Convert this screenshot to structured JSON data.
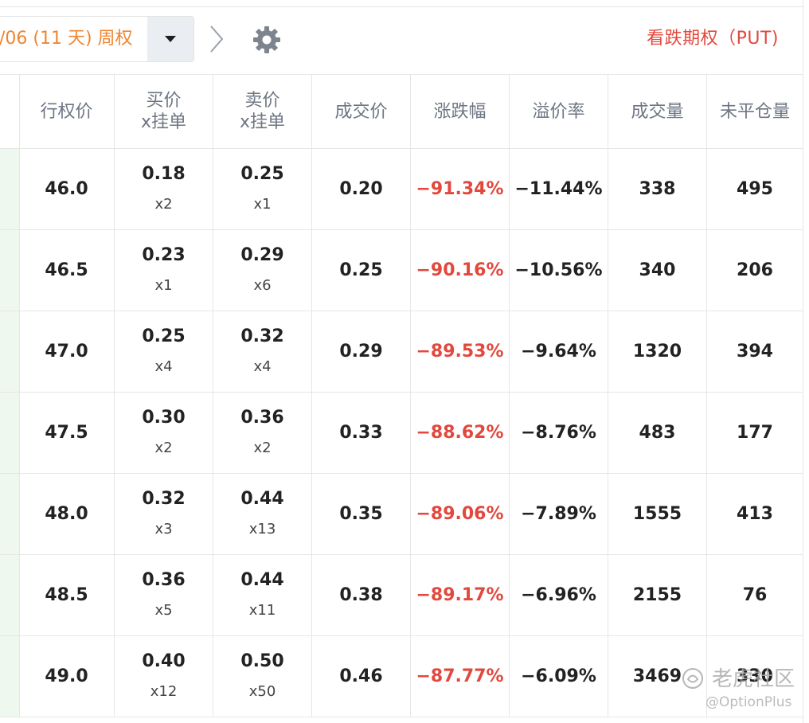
{
  "toolbar": {
    "expiry_label": "/06 (11 天) 周权",
    "put_label": "看跌期权（PUT)",
    "icons": {
      "caret": "caret-down-icon",
      "next": "chevron-right-icon",
      "settings": "gear-icon"
    }
  },
  "table": {
    "headers": {
      "strike": "行权价",
      "bid_line1": "买价",
      "bid_line2": "x挂单",
      "ask_line1": "卖价",
      "ask_line2": "x挂单",
      "last": "成交价",
      "change": "涨跌幅",
      "premium": "溢价率",
      "volume": "成交量",
      "open_interest": "未平仓量"
    },
    "rows": [
      {
        "strike": "46.0",
        "bid": "0.18",
        "bid_size": "x2",
        "ask": "0.25",
        "ask_size": "x1",
        "last": "0.20",
        "change": "−91.34%",
        "premium": "−11.44%",
        "volume": "338",
        "oi": "495"
      },
      {
        "strike": "46.5",
        "bid": "0.23",
        "bid_size": "x1",
        "ask": "0.29",
        "ask_size": "x6",
        "last": "0.25",
        "change": "−90.16%",
        "premium": "−10.56%",
        "volume": "340",
        "oi": "206"
      },
      {
        "strike": "47.0",
        "bid": "0.25",
        "bid_size": "x4",
        "ask": "0.32",
        "ask_size": "x4",
        "last": "0.29",
        "change": "−89.53%",
        "premium": "−9.64%",
        "volume": "1320",
        "oi": "394"
      },
      {
        "strike": "47.5",
        "bid": "0.30",
        "bid_size": "x2",
        "ask": "0.36",
        "ask_size": "x2",
        "last": "0.33",
        "change": "−88.62%",
        "premium": "−8.76%",
        "volume": "483",
        "oi": "177"
      },
      {
        "strike": "48.0",
        "bid": "0.32",
        "bid_size": "x3",
        "ask": "0.44",
        "ask_size": "x13",
        "last": "0.35",
        "change": "−89.06%",
        "premium": "−7.89%",
        "volume": "1555",
        "oi": "413"
      },
      {
        "strike": "48.5",
        "bid": "0.36",
        "bid_size": "x5",
        "ask": "0.44",
        "ask_size": "x11",
        "last": "0.38",
        "change": "−89.17%",
        "premium": "−6.96%",
        "volume": "2155",
        "oi": "76"
      },
      {
        "strike": "49.0",
        "bid": "0.40",
        "bid_size": "x12",
        "ask": "0.50",
        "ask_size": "x50",
        "last": "0.46",
        "change": "−87.77%",
        "premium": "−6.09%",
        "volume": "3469",
        "oi": "330"
      }
    ]
  },
  "watermark": {
    "brand": "老虎社区",
    "handle": "@OptionPlus"
  },
  "colors": {
    "negative": "#e2483d",
    "expiry": "#f0852f",
    "header_text": "#6e7683",
    "strip": "#eef8ee"
  }
}
